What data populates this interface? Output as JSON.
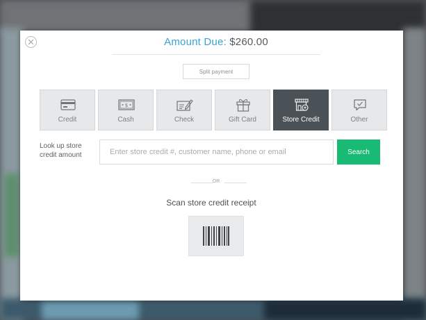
{
  "modal": {
    "title_label": "Amount Due: ",
    "amount_due": "$260.00",
    "split_payment_label": "Split payment"
  },
  "tabs": [
    {
      "label": "Credit",
      "icon": "credit-card-icon"
    },
    {
      "label": "Cash",
      "icon": "cash-icon"
    },
    {
      "label": "Check",
      "icon": "check-icon"
    },
    {
      "label": "Gift Card",
      "icon": "gift-card-icon"
    },
    {
      "label": "Store Credit",
      "icon": "store-credit-icon",
      "active": true
    },
    {
      "label": "Other",
      "icon": "other-icon"
    }
  ],
  "lookup": {
    "label_line1": "Look up store",
    "label_line2": "credit amount",
    "placeholder": "Enter store credit #, customer name, phone or email",
    "value": "",
    "search_label": "Search"
  },
  "divider": {
    "or_text": "OR"
  },
  "scan": {
    "label": "Scan store credit receipt",
    "icon": "barcode-icon"
  },
  "colors": {
    "accent_blue": "#3aa2d6",
    "search_green": "#19ba74",
    "active_tab": "#4b5257"
  }
}
